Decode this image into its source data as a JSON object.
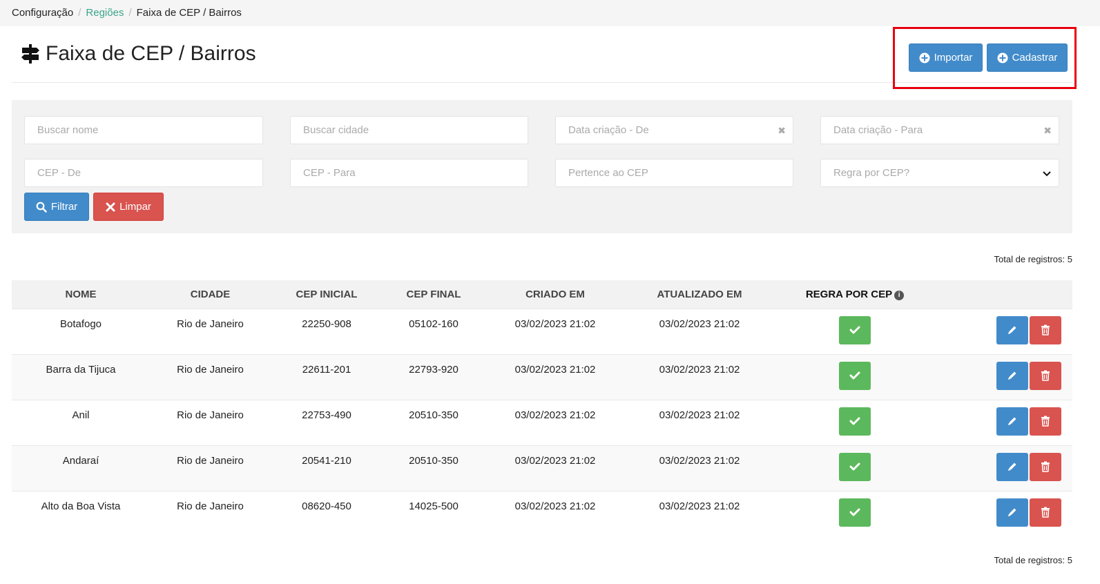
{
  "breadcrumb": [
    {
      "label": "Configuração",
      "link": false
    },
    {
      "label": "Regiões",
      "link": true
    },
    {
      "label": "Faixa de CEP / Bairros",
      "link": false
    }
  ],
  "header": {
    "title": "Faixa de CEP / Bairros",
    "import_label": "Importar",
    "create_label": "Cadastrar"
  },
  "filters": {
    "name_placeholder": "Buscar nome",
    "city_placeholder": "Buscar cidade",
    "date_from_placeholder": "Data criação - De",
    "date_to_placeholder": "Data criação - Para",
    "cep_from_placeholder": "CEP - De",
    "cep_to_placeholder": "CEP - Para",
    "belongs_placeholder": "Pertence ao CEP",
    "rule_select_value": "Regra por CEP?",
    "filter_label": "Filtrar",
    "clear_label": "Limpar"
  },
  "total_label": "Total de registros: 5",
  "table": {
    "columns": [
      "NOME",
      "CIDADE",
      "CEP INICIAL",
      "CEP FINAL",
      "CRIADO EM",
      "ATUALIZADO EM",
      "REGRA POR CEP"
    ],
    "rows": [
      {
        "nome": "Botafogo",
        "cidade": "Rio de Janeiro",
        "cep_inicial": "22250-908",
        "cep_final": "05102-160",
        "criado": "03/02/2023 21:02",
        "atualizado": "03/02/2023 21:02"
      },
      {
        "nome": "Barra da Tijuca",
        "cidade": "Rio de Janeiro",
        "cep_inicial": "22611-201",
        "cep_final": "22793-920",
        "criado": "03/02/2023 21:02",
        "atualizado": "03/02/2023 21:02"
      },
      {
        "nome": "Anil",
        "cidade": "Rio de Janeiro",
        "cep_inicial": "22753-490",
        "cep_final": "20510-350",
        "criado": "03/02/2023 21:02",
        "atualizado": "03/02/2023 21:02"
      },
      {
        "nome": "Andaraí",
        "cidade": "Rio de Janeiro",
        "cep_inicial": "20541-210",
        "cep_final": "20510-350",
        "criado": "03/02/2023 21:02",
        "atualizado": "03/02/2023 21:02"
      },
      {
        "nome": "Alto da Boa Vista",
        "cidade": "Rio de Janeiro",
        "cep_inicial": "08620-450",
        "cep_final": "14025-500",
        "criado": "03/02/2023 21:02",
        "atualizado": "03/02/2023 21:02"
      }
    ]
  },
  "colors": {
    "primary": "#428bca",
    "danger": "#d9534f",
    "success": "#5cb85c",
    "link": "#3aa58a",
    "highlight": "#e8000f"
  },
  "icons": {
    "title": "signpost-icon",
    "import": "plus-circle-icon",
    "create": "plus-circle-icon",
    "filter": "search-icon",
    "clear": "close-icon",
    "rule": "check-icon",
    "edit": "pencil-icon",
    "delete": "trash-icon",
    "info": "info-icon"
  }
}
